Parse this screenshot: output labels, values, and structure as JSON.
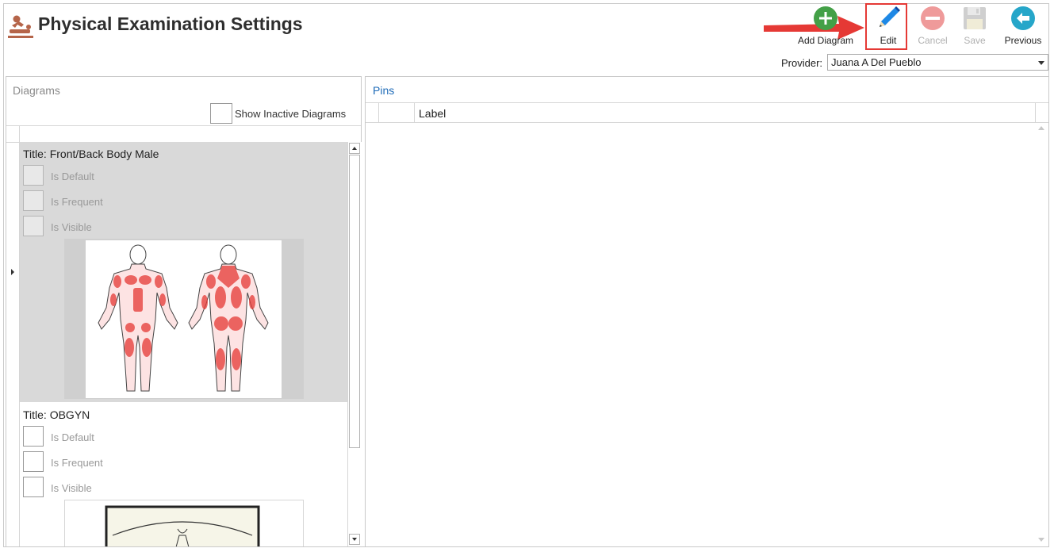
{
  "header": {
    "title": "Physical Examination Settings",
    "icon": "massage-therapy-icon"
  },
  "toolbar": {
    "add_diagram_label": "Add Diagram",
    "edit_label": "Edit",
    "cancel_label": "Cancel",
    "save_label": "Save",
    "previous_label": "Previous"
  },
  "provider": {
    "label": "Provider:",
    "value": "Juana A Del Pueblo"
  },
  "diagrams_panel": {
    "title": "Diagrams",
    "show_inactive_label": "Show Inactive Diagrams",
    "items": [
      {
        "title": "Title: Front/Back Body Male",
        "is_default_label": "Is Default",
        "is_frequent_label": "Is Frequent",
        "is_visible_label": "Is Visible"
      },
      {
        "title": "Title: OBGYN",
        "is_default_label": "Is Default",
        "is_frequent_label": "Is Frequent",
        "is_visible_label": "Is Visible"
      }
    ]
  },
  "pins_panel": {
    "title": "Pins",
    "column_label": "Label"
  },
  "colors": {
    "accent_blue": "#1e6bb8",
    "highlight_red": "#e53935",
    "add_green": "#43a047",
    "disabled_red": "#ef9a9a",
    "previous_teal": "#26a6c9",
    "selected_row": "#d9d9d9"
  }
}
